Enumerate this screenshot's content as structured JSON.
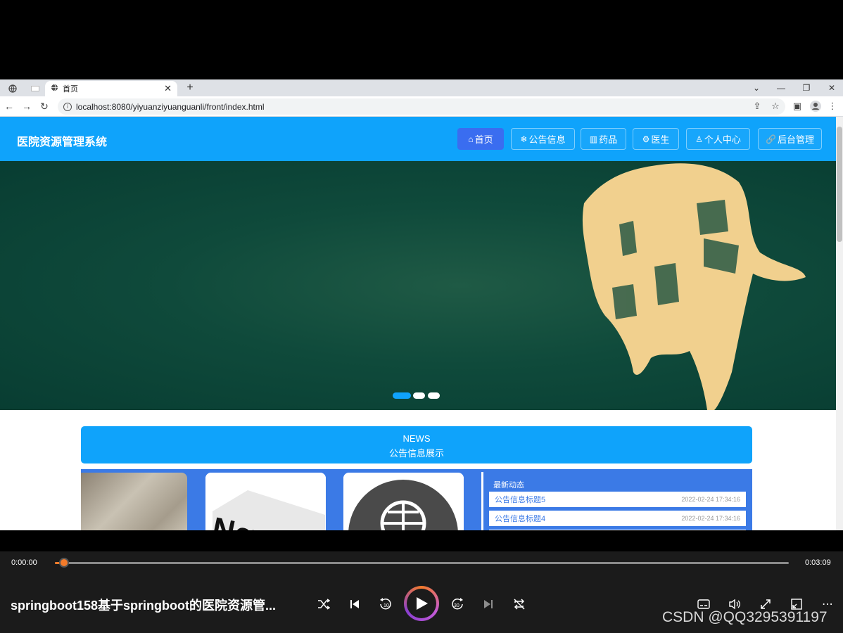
{
  "browser": {
    "tab_title": "首页",
    "url": "localhost:8080/yiyuanziyuanguanli/front/index.html"
  },
  "site": {
    "title": "医院资源管理系统",
    "nav": [
      {
        "label": "首页",
        "icon": "home-icon",
        "active": true
      },
      {
        "label": "公告信息",
        "icon": "snowflake-icon",
        "active": false
      },
      {
        "label": "药品",
        "icon": "shop-icon",
        "active": false
      },
      {
        "label": "医生",
        "icon": "cog-icon",
        "active": false
      },
      {
        "label": "个人中心",
        "icon": "user-icon",
        "active": false
      },
      {
        "label": "后台管理",
        "icon": "link-icon",
        "active": false
      }
    ]
  },
  "banner": {
    "slides_count": 3,
    "active_slide": 1
  },
  "news": {
    "title_en": "NEWS",
    "title_cn": "公告信息展示",
    "latest_title": "最新动态",
    "latest": [
      {
        "title": "公告信息标题5",
        "date": "2022-02-24 17:34:16"
      },
      {
        "title": "公告信息标题4",
        "date": "2022-02-24 17:34:16"
      }
    ]
  },
  "player": {
    "time_current": "0:00:00",
    "time_total": "0:03:09",
    "progress": 0.01,
    "title": "springboot158基于springboot的医院资源管...",
    "watermark": "CSDN @QQ3295391197"
  },
  "colors": {
    "header_blue": "#0fa3fb",
    "nav_active": "#3a6df0",
    "panel_blue": "#3b7ae6",
    "banner_green": "#0f4a3b",
    "player_accent": "#f47b2a"
  }
}
